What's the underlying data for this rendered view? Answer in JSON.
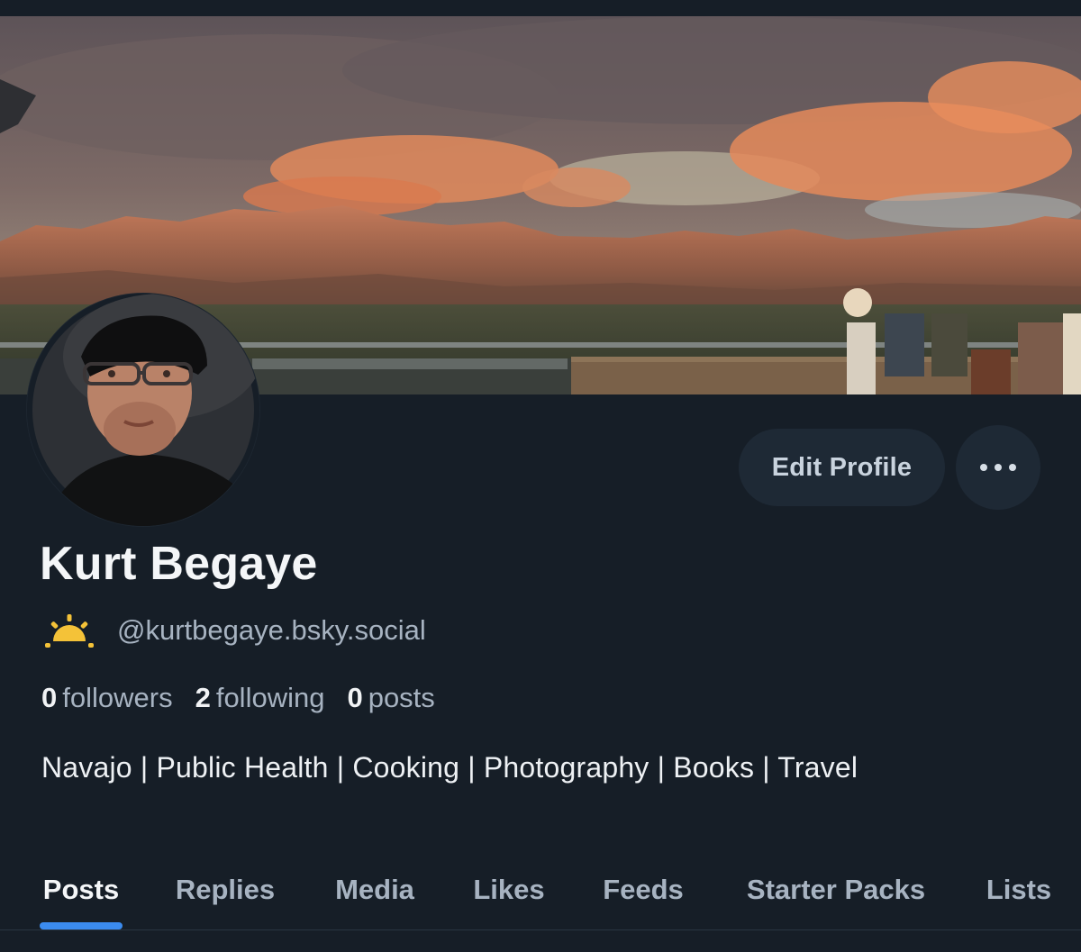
{
  "profile": {
    "display_name": "Kurt Begaye",
    "handle": "@kurtbegaye.bsky.social",
    "bio": "Navajo | Public Health | Cooking | Photography | Books | Travel"
  },
  "actions": {
    "edit_profile_label": "Edit Profile",
    "more_icon": "ellipsis-icon"
  },
  "stats": {
    "followers_count": "0",
    "followers_label": "followers",
    "following_count": "2",
    "following_label": "following",
    "posts_count": "0",
    "posts_label": "posts"
  },
  "icons": {
    "status_icon": "sunrise-icon"
  },
  "tabs": [
    {
      "label": "Posts",
      "active": true
    },
    {
      "label": "Replies"
    },
    {
      "label": "Media"
    },
    {
      "label": "Likes"
    },
    {
      "label": "Feeds"
    },
    {
      "label": "Starter Packs"
    },
    {
      "label": "Lists"
    }
  ],
  "colors": {
    "background": "#161e27",
    "button_bg": "#1e2935",
    "accent": "#3b8bee",
    "muted_text": "#a7b3c1",
    "sun_icon": "#f4c238"
  }
}
